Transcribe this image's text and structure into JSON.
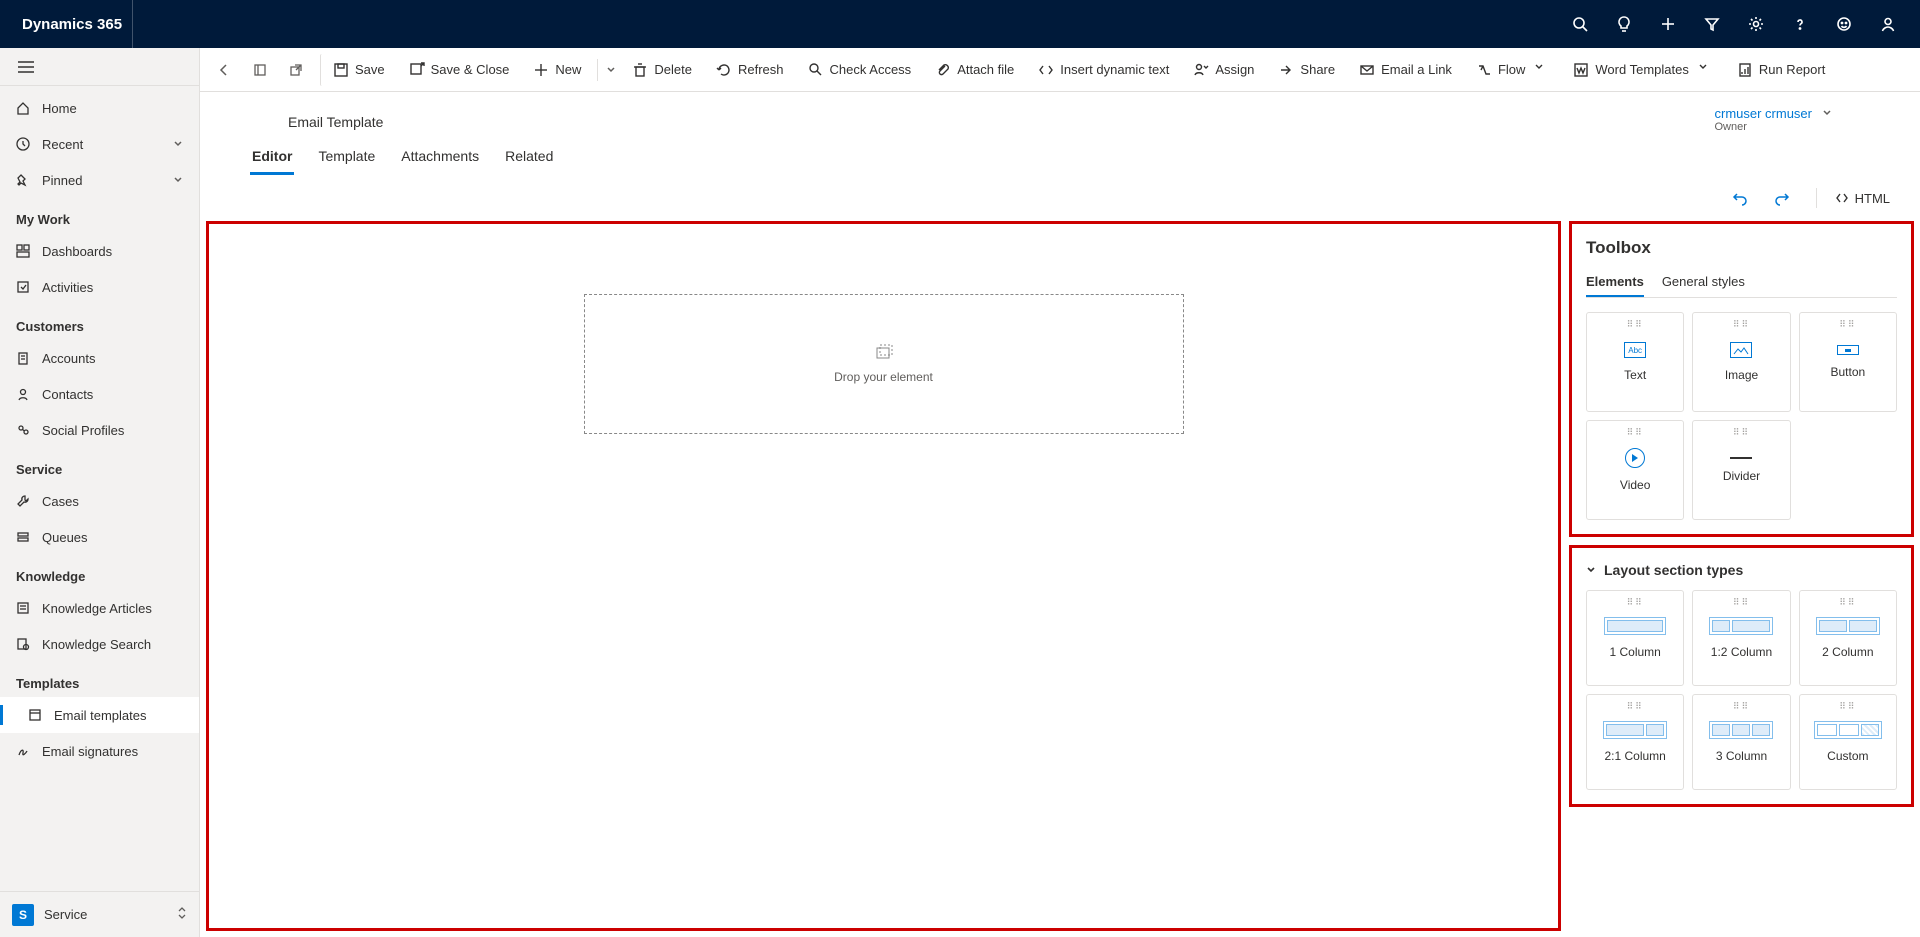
{
  "brand": "Dynamics 365",
  "leftnav": {
    "top": [
      {
        "label": "Home"
      },
      {
        "label": "Recent",
        "expandable": true
      },
      {
        "label": "Pinned",
        "expandable": true
      }
    ],
    "groups": [
      {
        "title": "My Work",
        "items": [
          "Dashboards",
          "Activities"
        ]
      },
      {
        "title": "Customers",
        "items": [
          "Accounts",
          "Contacts",
          "Social Profiles"
        ]
      },
      {
        "title": "Service",
        "items": [
          "Cases",
          "Queues"
        ]
      },
      {
        "title": "Knowledge",
        "items": [
          "Knowledge Articles",
          "Knowledge Search"
        ]
      },
      {
        "title": "Templates",
        "items": [
          "Email templates",
          "Email signatures"
        ],
        "selected": "Email templates"
      }
    ],
    "area": {
      "badge": "S",
      "label": "Service"
    }
  },
  "cmdbar": {
    "save": "Save",
    "saveclose": "Save & Close",
    "new": "New",
    "delete": "Delete",
    "refresh": "Refresh",
    "check": "Check Access",
    "attach": "Attach file",
    "insertdyn": "Insert dynamic text",
    "assign": "Assign",
    "share": "Share",
    "emaillink": "Email a Link",
    "flow": "Flow",
    "wordtpl": "Word Templates",
    "runreport": "Run Report"
  },
  "record": {
    "type": "Email Template",
    "owner": "crmuser crmuser",
    "ownerLabel": "Owner"
  },
  "tabs": [
    "Editor",
    "Template",
    "Attachments",
    "Related"
  ],
  "activeTab": "Editor",
  "editorActions": {
    "html": "HTML"
  },
  "canvas": {
    "dropHint": "Drop your element"
  },
  "toolbox": {
    "title": "Toolbox",
    "tabs": [
      "Elements",
      "General styles"
    ],
    "activeTab": "Elements",
    "elements": [
      "Text",
      "Image",
      "Button",
      "Video",
      "Divider"
    ]
  },
  "layoutSection": {
    "title": "Layout section types",
    "items": [
      "1 Column",
      "1:2 Column",
      "2 Column",
      "2:1 Column",
      "3 Column",
      "Custom"
    ]
  }
}
